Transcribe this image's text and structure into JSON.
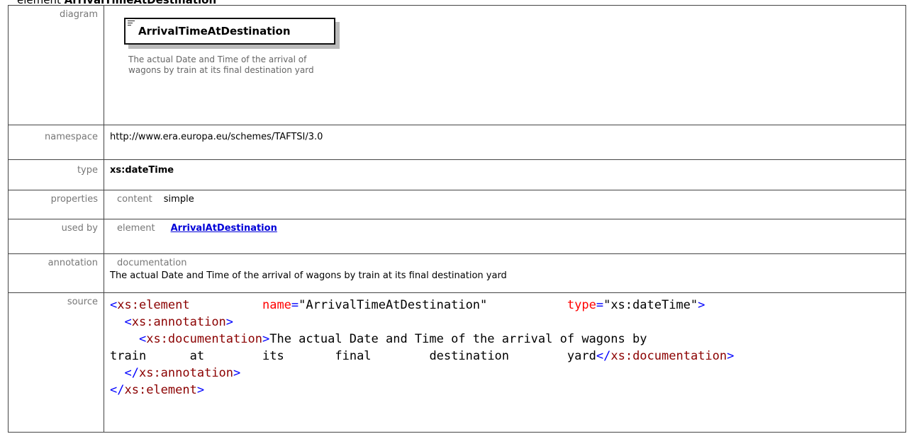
{
  "page": {
    "title_prefix": "element",
    "title_name": "ArrivalTimeAtDestination"
  },
  "labels": {
    "diagram": "diagram",
    "namespace": "namespace",
    "type": "type",
    "properties": "properties",
    "used_by": "used by",
    "annotation": "annotation",
    "source": "source"
  },
  "diagram": {
    "element_name": "ArrivalTimeAtDestination",
    "documentation": "The actual Date and Time of the arrival of wagons by train at its final destination yard"
  },
  "namespace": "http://www.era.europa.eu/schemes/TAFTSI/3.0",
  "type": "xs:dateTime",
  "properties": {
    "key": "content",
    "value": "simple"
  },
  "used_by": {
    "key": "element",
    "link": "ArrivalAtDestination"
  },
  "annotation": {
    "key": "documentation",
    "text": "The actual Date and Time of the arrival of wagons by train at its final destination yard"
  },
  "source": {
    "line1_tag": "<xs:element",
    "line1_attr1_name": "name",
    "line1_attr1_value": "\"ArrivalTimeAtDestination\"",
    "line1_attr2_name": "type",
    "line1_attr2_value": "\"xs:dateTime\"",
    "line1_close": ">",
    "line2": "<xs:annotation>",
    "line3_open": "<xs:documentation>",
    "line3_text": "The actual Date and Time of the arrival of wagons by",
    "line4_text_words": [
      "train",
      "at",
      "its",
      "final",
      "destination",
      "yard"
    ],
    "line4_close": "</xs:documentation>",
    "line5": "</xs:annotation>",
    "line6": "</xs:element>"
  },
  "colors": {
    "tag": "#8b0000",
    "punct": "#0000ff",
    "attr": "#ff0000",
    "link": "#0000d8"
  }
}
